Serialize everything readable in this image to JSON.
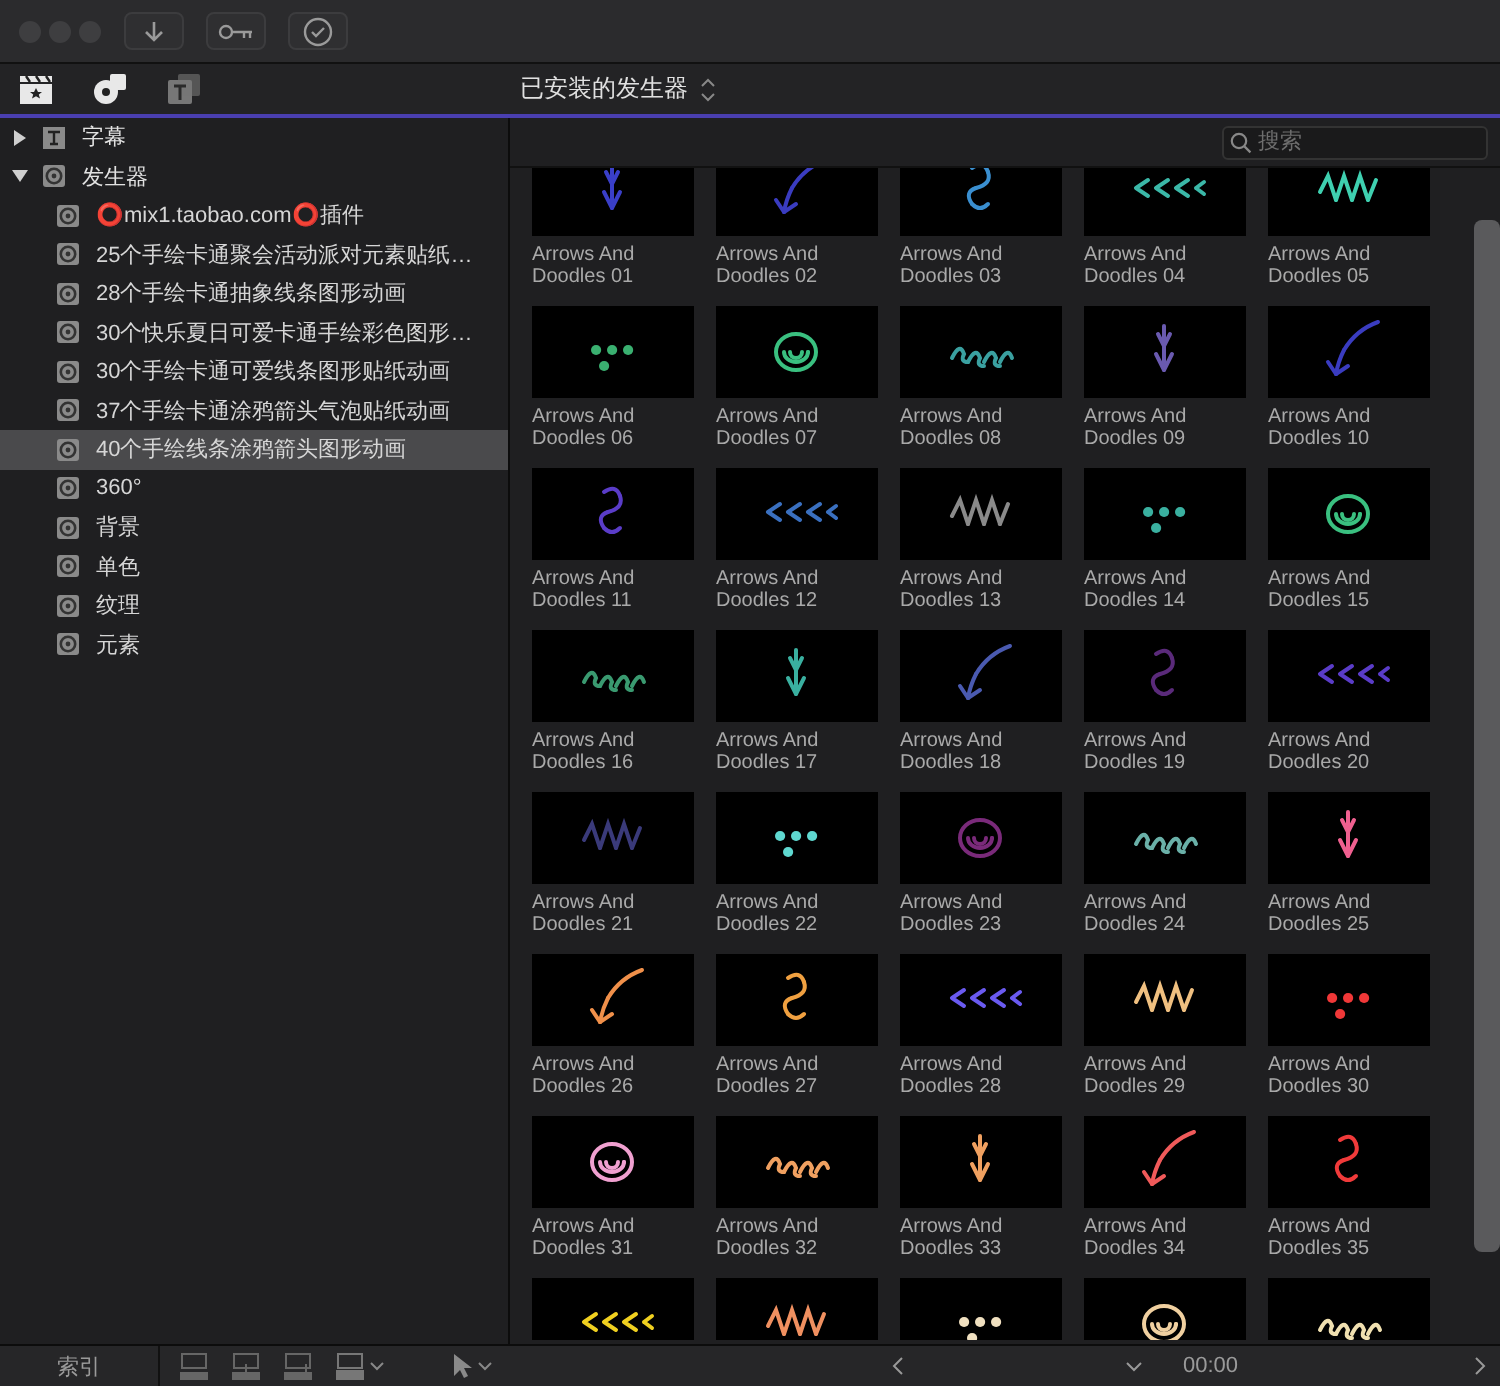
{
  "library_title": "已安装的发生器",
  "sidebar": {
    "items": [
      {
        "label": "字幕",
        "kind": "titles",
        "expanded": false,
        "selected": false
      },
      {
        "label": "发生器",
        "kind": "generators",
        "expanded": true,
        "selected": false,
        "children": [
          {
            "label": "⭕mix1.taobao.com⭕插件",
            "kind": "generators",
            "selected": false
          },
          {
            "label": "25个手绘卡通聚会活动派对元素贴纸…",
            "kind": "generators",
            "selected": false
          },
          {
            "label": "28个手绘卡通抽象线条图形动画",
            "kind": "generators",
            "selected": false
          },
          {
            "label": "30个快乐夏日可爱卡通手绘彩色图形…",
            "kind": "generators",
            "selected": false
          },
          {
            "label": "30个手绘卡通可爱线条图形贴纸动画",
            "kind": "generators",
            "selected": false
          },
          {
            "label": "37个手绘卡通涂鸦箭头气泡贴纸动画",
            "kind": "generators",
            "selected": false
          },
          {
            "label": "40个手绘线条涂鸦箭头图形动画",
            "kind": "generators",
            "selected": true
          },
          {
            "label": "360°",
            "kind": "generators",
            "selected": false
          },
          {
            "label": "背景",
            "kind": "generators",
            "selected": false
          },
          {
            "label": "单色",
            "kind": "generators",
            "selected": false
          },
          {
            "label": "纹理",
            "kind": "generators",
            "selected": false
          },
          {
            "label": "元素",
            "kind": "generators",
            "selected": false
          }
        ]
      }
    ]
  },
  "search": {
    "placeholder": "搜索"
  },
  "grid": {
    "items": [
      {
        "label": "Arrows And Doodles 01"
      },
      {
        "label": "Arrows And Doodles 02"
      },
      {
        "label": "Arrows And Doodles 03"
      },
      {
        "label": "Arrows And Doodles 04"
      },
      {
        "label": "Arrows And Doodles 05"
      },
      {
        "label": "Arrows And Doodles 06"
      },
      {
        "label": "Arrows And Doodles 07"
      },
      {
        "label": "Arrows And Doodles 08"
      },
      {
        "label": "Arrows And Doodles 09"
      },
      {
        "label": "Arrows And Doodles 10"
      },
      {
        "label": "Arrows And Doodles 11"
      },
      {
        "label": "Arrows And Doodles 12"
      },
      {
        "label": "Arrows And Doodles 13"
      },
      {
        "label": "Arrows And Doodles 14"
      },
      {
        "label": "Arrows And Doodles 15"
      },
      {
        "label": "Arrows And Doodles 16"
      },
      {
        "label": "Arrows And Doodles 17"
      },
      {
        "label": "Arrows And Doodles 18"
      },
      {
        "label": "Arrows And Doodles 19"
      },
      {
        "label": "Arrows And Doodles 20"
      },
      {
        "label": "Arrows And Doodles 21"
      },
      {
        "label": "Arrows And Doodles 22"
      },
      {
        "label": "Arrows And Doodles 23"
      },
      {
        "label": "Arrows And Doodles 24"
      },
      {
        "label": "Arrows And Doodles 25"
      },
      {
        "label": "Arrows And Doodles 26"
      },
      {
        "label": "Arrows And Doodles 27"
      },
      {
        "label": "Arrows And Doodles 28"
      },
      {
        "label": "Arrows And Doodles 29"
      },
      {
        "label": "Arrows And Doodles 30"
      },
      {
        "label": "Arrows And Doodles 31"
      },
      {
        "label": "Arrows And Doodles 32"
      },
      {
        "label": "Arrows And Doodles 33"
      },
      {
        "label": "Arrows And Doodles 34"
      },
      {
        "label": "Arrows And Doodles 35"
      },
      {
        "kind": "picture"
      },
      {
        "kind": "picture"
      },
      {
        "kind": "picture"
      },
      {
        "kind": "picture"
      },
      {
        "kind": "picture"
      }
    ]
  },
  "bottom_bar": {
    "index_button": "索引",
    "timecode": "00:00"
  }
}
